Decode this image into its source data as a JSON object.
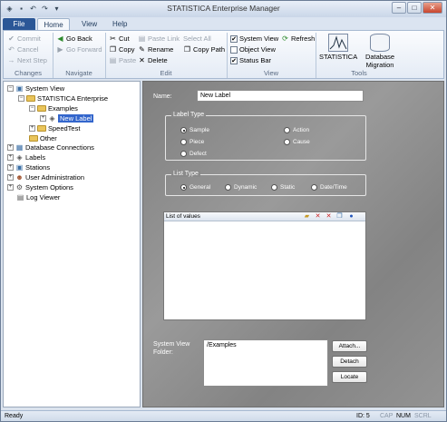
{
  "window": {
    "title": "STATISTICA Enterprise Manager"
  },
  "tabs": {
    "file": "File",
    "home": "Home",
    "view": "View",
    "help": "Help"
  },
  "ribbon": {
    "changes": {
      "commit": "Commit",
      "cancel": "Cancel",
      "next_step": "Next Step",
      "label": "Changes"
    },
    "navigate": {
      "go_back": "Go Back",
      "go_forward": "Go Forward",
      "label": "Navigate"
    },
    "edit": {
      "cut": "Cut",
      "copy": "Copy",
      "paste": "Paste",
      "paste_link": "Paste Link",
      "rename": "Rename",
      "delete": "Delete",
      "select_all": "Select All",
      "copy_path": "Copy Path",
      "label": "Edit"
    },
    "view": {
      "system_view": "System View",
      "object_view": "Object View",
      "status_bar": "Status Bar",
      "refresh": "Refresh",
      "label": "View"
    },
    "tools": {
      "statistica": "STATISTICA",
      "db_migration_1": "Database",
      "db_migration_2": "Migration",
      "label": "Tools"
    }
  },
  "tree": {
    "system_view": "System View",
    "statistica_enterprise": "STATISTICA Enterprise",
    "examples": "Examples",
    "new_label": "New Label",
    "speedtest": "SpeedTest",
    "other": "Other",
    "database_connections": "Database Connections",
    "labels": "Labels",
    "stations": "Stations",
    "user_administration": "User Administration",
    "system_options": "System Options",
    "log_viewer": "Log Viewer"
  },
  "form": {
    "name_label": "Name:",
    "name_value": "New Label",
    "label_type": {
      "title": "Label Type",
      "sample": "Sample",
      "piece": "Piece",
      "defect": "Defect",
      "action": "Action",
      "cause": "Cause",
      "selected": "Sample"
    },
    "list_type": {
      "title": "List Type",
      "general": "General",
      "dynamic": "Dynamic",
      "static": "Static",
      "datetime": "Date/Time",
      "selected": "General"
    },
    "list_of_values": "List of values",
    "folder_label_1": "System View",
    "folder_label_2": "Folder:",
    "folder_value": "/Examples",
    "attach": "Attach...",
    "detach": "Detach",
    "locate": "Locate"
  },
  "status": {
    "ready": "Ready",
    "id": "ID: 5",
    "cap": "CAP",
    "num": "NUM",
    "scrl": "SCRL"
  },
  "colors": {
    "accent": "#2b5797",
    "selection": "#3366cc",
    "panel": "#8a8a8a"
  }
}
